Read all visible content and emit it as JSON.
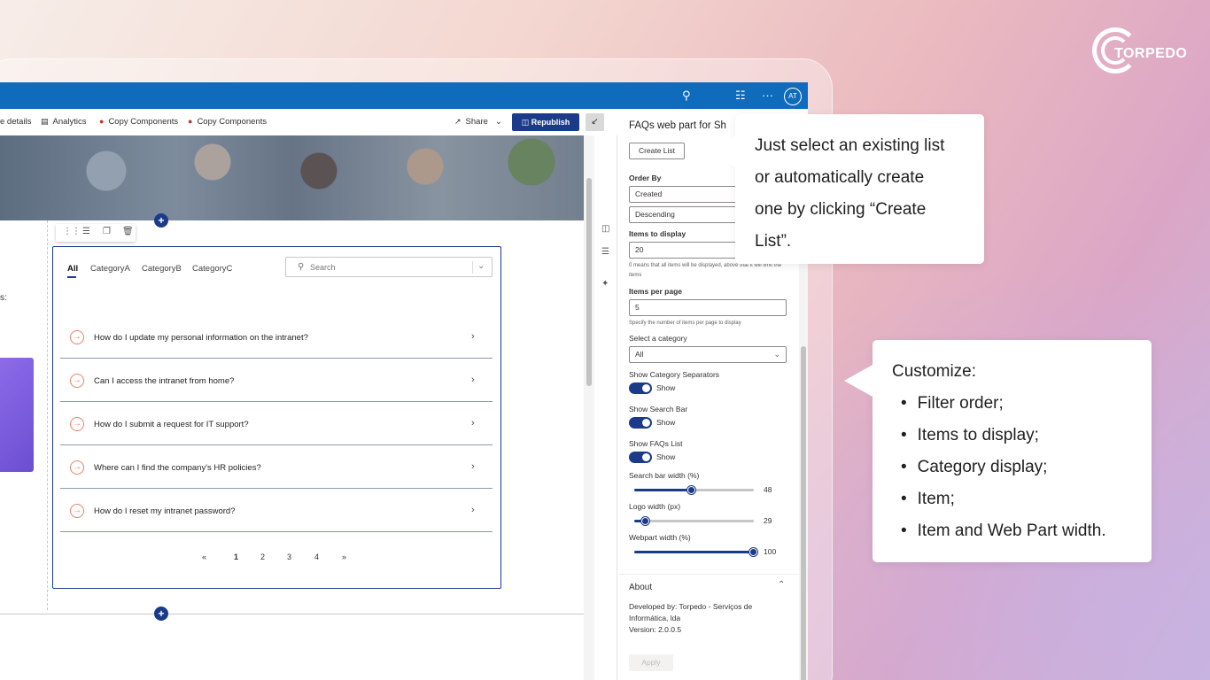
{
  "brand": {
    "name": "TORPEDO"
  },
  "topbar": {
    "avatar_initials": "AT"
  },
  "commandbar": {
    "page_details": "e details",
    "analytics": "Analytics",
    "copy1": "Copy Components",
    "copy2": "Copy Components",
    "share": "Share",
    "republish": "Republish"
  },
  "faq": {
    "tabs": [
      "All",
      "CategoryA",
      "CategoryB",
      "CategoryC"
    ],
    "search_placeholder": "Search",
    "questions": [
      "How do I update my personal information on the intranet?",
      "Can I access the intranet from home?",
      "How do I submit a request for IT support?",
      "Where can I find the company's HR policies?",
      "How do I reset my intranet password?"
    ],
    "pages": [
      "1",
      "2",
      "3",
      "4"
    ]
  },
  "pane": {
    "title": "FAQs web part for Sh",
    "create_list": "Create List",
    "order_by_label": "Order By",
    "order_by_value": "Created",
    "order_direction": "Descending",
    "items_display_label": "Items to display",
    "items_display_value": "20",
    "items_display_hint": "0 means that all items will be displayed, above that it will limit the items",
    "items_per_page_label": "Items per page",
    "items_per_page_value": "5",
    "items_per_page_hint": "Specify the number of items per page to display",
    "category_label": "Select a category",
    "category_value": "All",
    "show_separators_label": "Show Category Separators",
    "show_search_label": "Show Search Bar",
    "show_faqs_label": "Show FAQs List",
    "toggle_text": "Show",
    "search_width_label": "Search bar width (%)",
    "search_width_value": 48,
    "logo_width_label": "Logo width (px)",
    "logo_width_value": 29,
    "webpart_width_label": "Webpart width (%)",
    "webpart_width_value": 100,
    "about_title": "About",
    "developed_by": "Developed by: Torpedo - Serviços de Informática, lda",
    "version": "Version: 2.0.0.5",
    "apply": "Apply"
  },
  "callout1": {
    "lines": [
      "Just select an existing list",
      "or automatically create",
      "one by clicking “Create",
      "List”."
    ]
  },
  "callout2": {
    "heading": "Customize:",
    "items": [
      "Filter order;",
      "Items to display;",
      "Category display;",
      "Item;",
      "Item and Web Part width."
    ]
  }
}
